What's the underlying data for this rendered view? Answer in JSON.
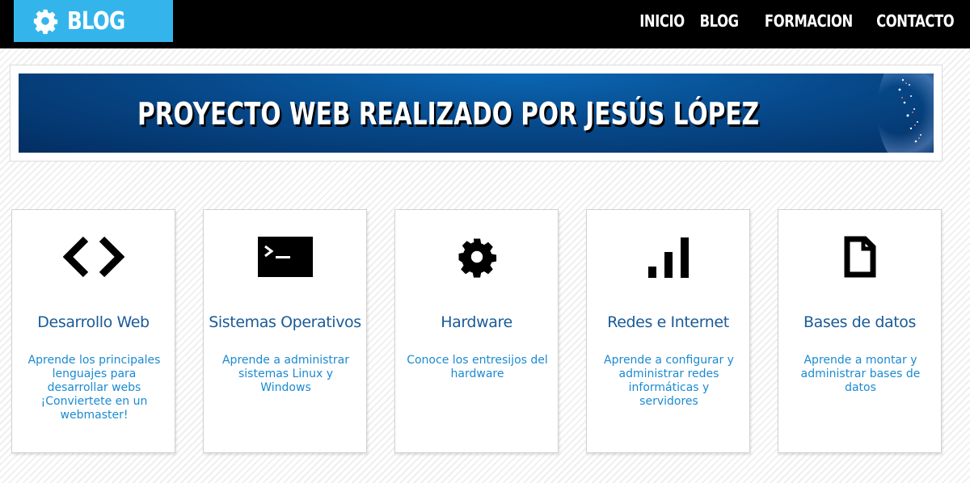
{
  "header": {
    "logo_text": "BLOG",
    "nav": [
      {
        "label": "INICIO"
      },
      {
        "label": "BLOG"
      },
      {
        "label": "FORMACION"
      },
      {
        "label": "CONTACTO"
      }
    ]
  },
  "banner": {
    "title": "PROYECTO WEB REALIZADO POR JESÚS LÓPEZ"
  },
  "cards": [
    {
      "icon": "code-icon",
      "title": "Desarrollo Web",
      "description": "Aprende los principales lenguajes para desarrollar webs ¡Conviertete en un webmaster!"
    },
    {
      "icon": "terminal-icon",
      "title": "Sistemas Operativos",
      "description": "Aprende a administrar sistemas Linux y Windows"
    },
    {
      "icon": "gear-icon",
      "title": "Hardware",
      "description": "Conoce los entresijos del hardware"
    },
    {
      "icon": "signal-bars-icon",
      "title": "Redes e Internet",
      "description": "Aprende a configurar y administrar redes informáticas y servidores"
    },
    {
      "icon": "document-icon",
      "title": "Bases de datos",
      "description": "Aprende a montar y administrar bases de datos"
    }
  ],
  "colors": {
    "accent": "#33b5ec",
    "header_bg": "#000000",
    "card_title": "#1a5b99",
    "card_text": "#1a8ad1"
  }
}
